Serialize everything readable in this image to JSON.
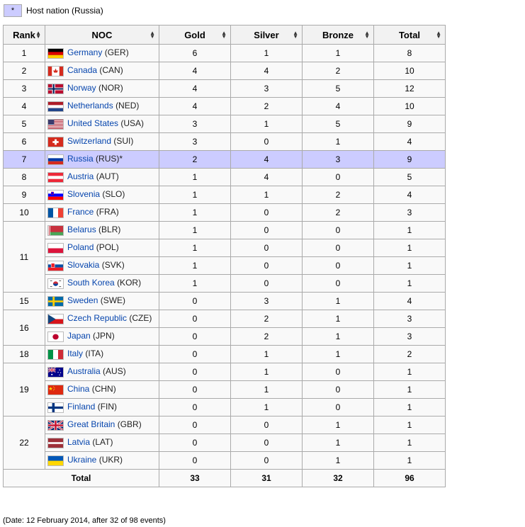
{
  "legend": {
    "marker": "*",
    "text": "Host nation (Russia)"
  },
  "headers": {
    "rank": "Rank",
    "noc": "NOC",
    "gold": "Gold",
    "silver": "Silver",
    "bronze": "Bronze",
    "total": "Total"
  },
  "rows": [
    {
      "rank": "1",
      "span": 1,
      "name": "Germany",
      "code": "(GER)",
      "flag": "GER",
      "gold": "6",
      "silver": "1",
      "bronze": "1",
      "total": "8"
    },
    {
      "rank": "2",
      "span": 1,
      "name": "Canada",
      "code": "(CAN)",
      "flag": "CAN",
      "gold": "4",
      "silver": "4",
      "bronze": "2",
      "total": "10"
    },
    {
      "rank": "3",
      "span": 1,
      "name": "Norway",
      "code": "(NOR)",
      "flag": "NOR",
      "gold": "4",
      "silver": "3",
      "bronze": "5",
      "total": "12"
    },
    {
      "rank": "4",
      "span": 1,
      "name": "Netherlands",
      "code": "(NED)",
      "flag": "NED",
      "gold": "4",
      "silver": "2",
      "bronze": "4",
      "total": "10"
    },
    {
      "rank": "5",
      "span": 1,
      "name": "United States",
      "code": "(USA)",
      "flag": "USA",
      "gold": "3",
      "silver": "1",
      "bronze": "5",
      "total": "9"
    },
    {
      "rank": "6",
      "span": 1,
      "name": "Switzerland",
      "code": "(SUI)",
      "flag": "SUI",
      "gold": "3",
      "silver": "0",
      "bronze": "1",
      "total": "4"
    },
    {
      "rank": "7",
      "span": 1,
      "name": "Russia",
      "code": "(RUS)*",
      "flag": "RUS",
      "gold": "2",
      "silver": "4",
      "bronze": "3",
      "total": "9",
      "host": true
    },
    {
      "rank": "8",
      "span": 1,
      "name": "Austria",
      "code": "(AUT)",
      "flag": "AUT",
      "gold": "1",
      "silver": "4",
      "bronze": "0",
      "total": "5"
    },
    {
      "rank": "9",
      "span": 1,
      "name": "Slovenia",
      "code": "(SLO)",
      "flag": "SLO",
      "gold": "1",
      "silver": "1",
      "bronze": "2",
      "total": "4"
    },
    {
      "rank": "10",
      "span": 1,
      "name": "France",
      "code": "(FRA)",
      "flag": "FRA",
      "gold": "1",
      "silver": "0",
      "bronze": "2",
      "total": "3"
    },
    {
      "rank": "11",
      "span": 4,
      "name": "Belarus",
      "code": "(BLR)",
      "flag": "BLR",
      "gold": "1",
      "silver": "0",
      "bronze": "0",
      "total": "1"
    },
    {
      "rank": null,
      "span": 0,
      "name": "Poland",
      "code": "(POL)",
      "flag": "POL",
      "gold": "1",
      "silver": "0",
      "bronze": "0",
      "total": "1"
    },
    {
      "rank": null,
      "span": 0,
      "name": "Slovakia",
      "code": "(SVK)",
      "flag": "SVK",
      "gold": "1",
      "silver": "0",
      "bronze": "0",
      "total": "1"
    },
    {
      "rank": null,
      "span": 0,
      "name": "South Korea",
      "code": "(KOR)",
      "flag": "KOR",
      "gold": "1",
      "silver": "0",
      "bronze": "0",
      "total": "1"
    },
    {
      "rank": "15",
      "span": 1,
      "name": "Sweden",
      "code": "(SWE)",
      "flag": "SWE",
      "gold": "0",
      "silver": "3",
      "bronze": "1",
      "total": "4"
    },
    {
      "rank": "16",
      "span": 2,
      "name": "Czech Republic",
      "code": "(CZE)",
      "flag": "CZE",
      "gold": "0",
      "silver": "2",
      "bronze": "1",
      "total": "3"
    },
    {
      "rank": null,
      "span": 0,
      "name": "Japan",
      "code": "(JPN)",
      "flag": "JPN",
      "gold": "0",
      "silver": "2",
      "bronze": "1",
      "total": "3"
    },
    {
      "rank": "18",
      "span": 1,
      "name": "Italy",
      "code": "(ITA)",
      "flag": "ITA",
      "gold": "0",
      "silver": "1",
      "bronze": "1",
      "total": "2"
    },
    {
      "rank": "19",
      "span": 3,
      "name": "Australia",
      "code": "(AUS)",
      "flag": "AUS",
      "gold": "0",
      "silver": "1",
      "bronze": "0",
      "total": "1"
    },
    {
      "rank": null,
      "span": 0,
      "name": "China",
      "code": "(CHN)",
      "flag": "CHN",
      "gold": "0",
      "silver": "1",
      "bronze": "0",
      "total": "1"
    },
    {
      "rank": null,
      "span": 0,
      "name": "Finland",
      "code": "(FIN)",
      "flag": "FIN",
      "gold": "0",
      "silver": "1",
      "bronze": "0",
      "total": "1"
    },
    {
      "rank": "22",
      "span": 3,
      "name": "Great Britain",
      "code": "(GBR)",
      "flag": "GBR",
      "gold": "0",
      "silver": "0",
      "bronze": "1",
      "total": "1"
    },
    {
      "rank": null,
      "span": 0,
      "name": "Latvia",
      "code": "(LAT)",
      "flag": "LAT",
      "gold": "0",
      "silver": "0",
      "bronze": "1",
      "total": "1"
    },
    {
      "rank": null,
      "span": 0,
      "name": "Ukraine",
      "code": "(UKR)",
      "flag": "UKR",
      "gold": "0",
      "silver": "0",
      "bronze": "1",
      "total": "1"
    }
  ],
  "totals": {
    "label": "Total",
    "gold": "33",
    "silver": "31",
    "bronze": "32",
    "total": "96"
  },
  "footnote": "(Date: 12 February 2014, after 32 of 98 events)",
  "colors": {
    "gold": "#ffd800",
    "silver": "#c0c0c0",
    "bronze": "#cc9966",
    "host": "#ccccff",
    "link": "#0645ad"
  }
}
